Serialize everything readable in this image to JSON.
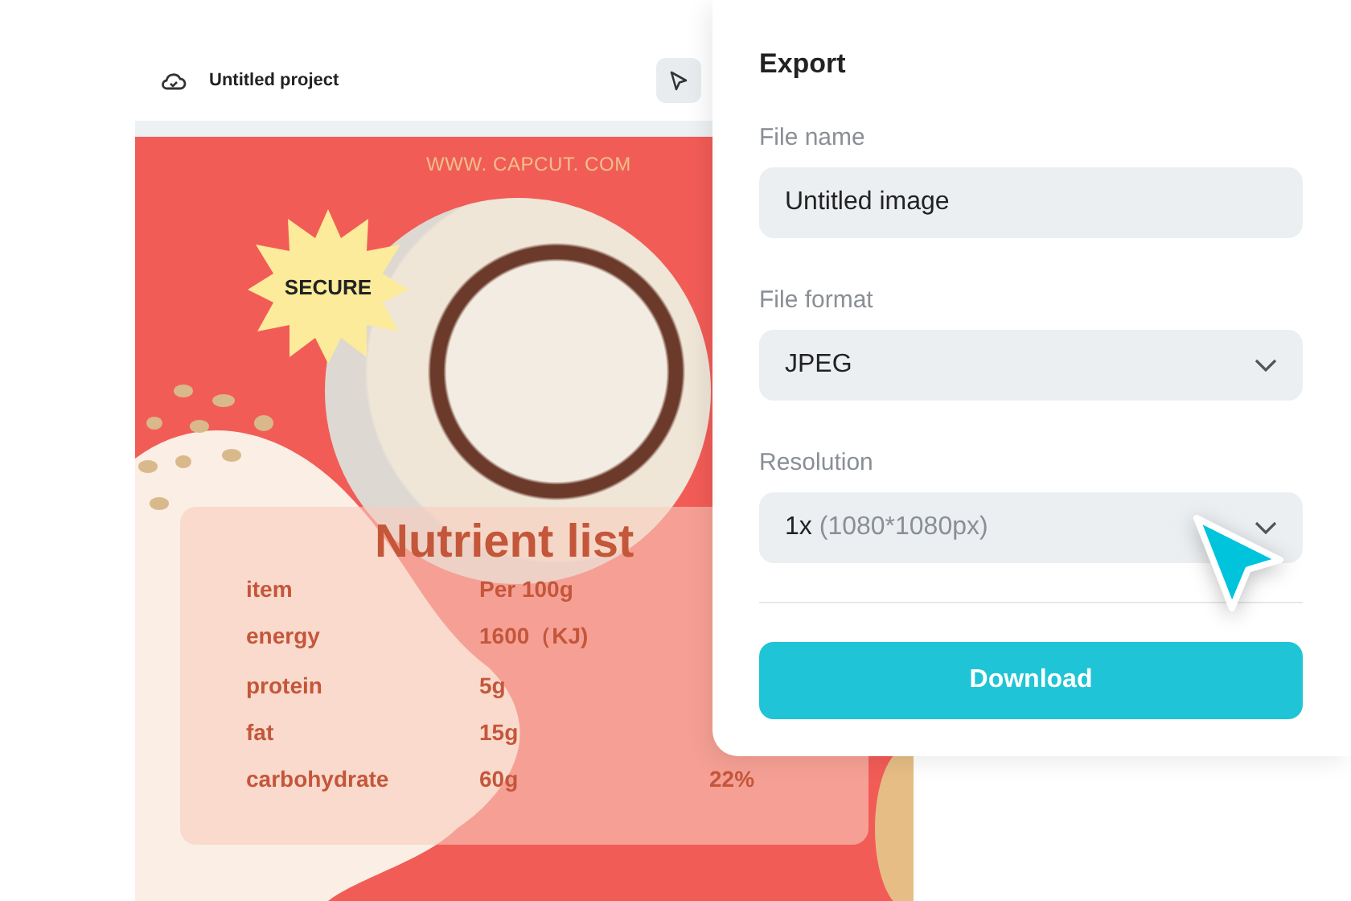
{
  "header": {
    "title": "Untitled project"
  },
  "poster": {
    "website": "WWW. CAPCUT. COM",
    "badge": "SECURE",
    "table": {
      "title": "Nutrient list",
      "rows": [
        {
          "label": "item",
          "value": "Per 100g"
        },
        {
          "label": "energy",
          "value": "1600（KJ)"
        },
        {
          "label": "protein",
          "value": "5g"
        },
        {
          "label": "fat",
          "value": "15g"
        },
        {
          "label": "carbohydrate",
          "value": "60g",
          "column_3": "22%"
        }
      ]
    }
  },
  "export": {
    "title": "Export",
    "fields": [
      {
        "kind": "text",
        "label": "File name",
        "value": "Untitled image"
      },
      {
        "kind": "select",
        "label": "File format",
        "value": "JPEG"
      },
      {
        "kind": "select",
        "label": "Resolution",
        "value": "1x",
        "detail": "(1080*1080px)"
      }
    ],
    "button": "Download"
  }
}
